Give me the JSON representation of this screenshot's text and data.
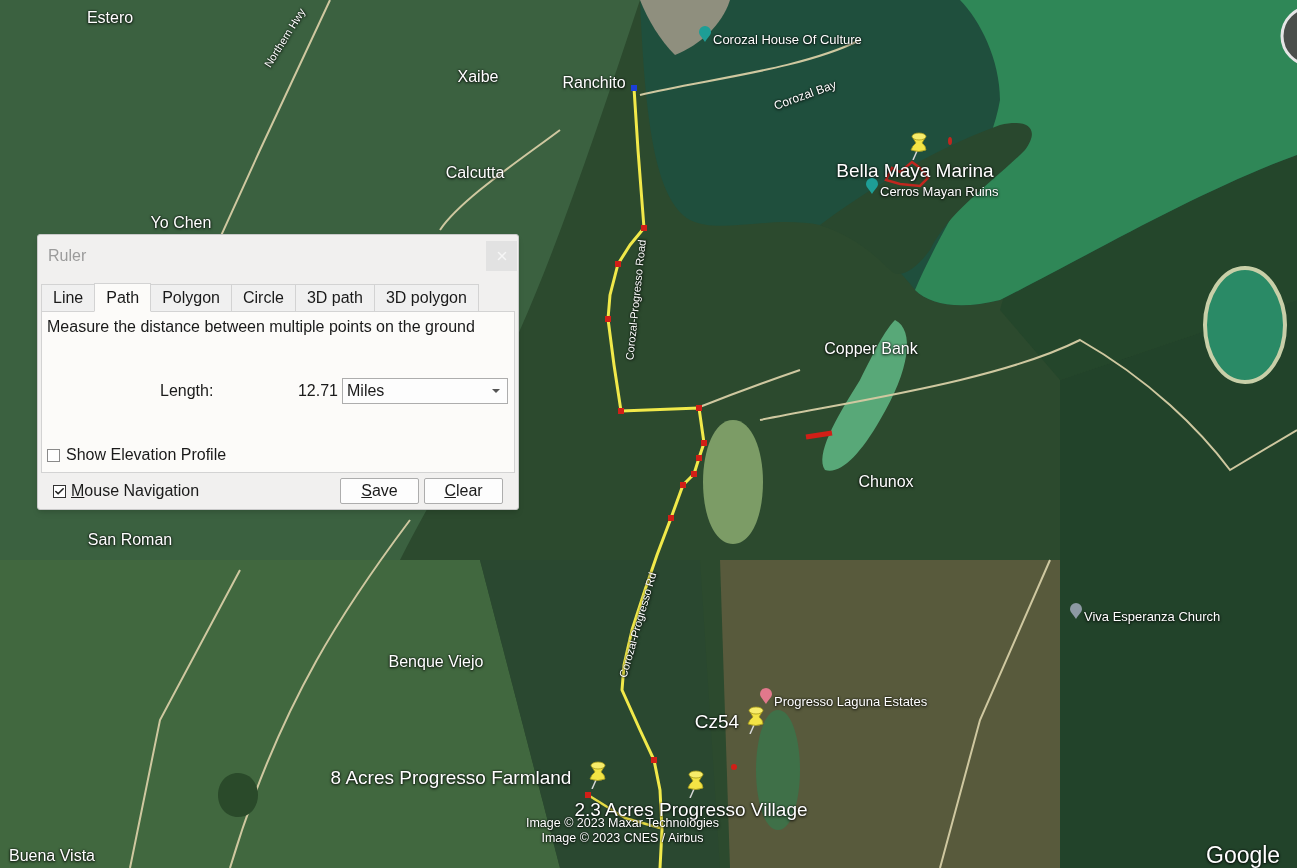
{
  "map": {
    "labels": [
      {
        "kind": "town",
        "text": "Estero"
      },
      {
        "kind": "poi",
        "text": "Corozal House Of Culture",
        "color": "#1e9e96"
      },
      {
        "kind": "road",
        "text": "Northern Hwy"
      },
      {
        "kind": "town",
        "text": "Xaibe"
      },
      {
        "kind": "town",
        "text": "Ranchito"
      },
      {
        "kind": "bay",
        "text": "Corozal Bay"
      },
      {
        "kind": "town",
        "text": "Calcutta"
      },
      {
        "kind": "placemark",
        "text": "Bella Maya Marina"
      },
      {
        "kind": "poi",
        "text": "Cerros Mayan Ruins",
        "color": "#1e9e96"
      },
      {
        "kind": "town",
        "text": "Yo Chen"
      },
      {
        "kind": "road",
        "text": "Corozal-Progresso Road"
      },
      {
        "kind": "town",
        "text": "Copper Bank"
      },
      {
        "kind": "town",
        "text": "Chunox"
      },
      {
        "kind": "town",
        "text": "San Roman"
      },
      {
        "kind": "poi",
        "text": "Viva Esperanza Church",
        "color": "#8d99a3"
      },
      {
        "kind": "road",
        "text": "Corozal-Progresso Rd"
      },
      {
        "kind": "town",
        "text": "Benque Viejo"
      },
      {
        "kind": "poi",
        "text": "Progresso Laguna Estates",
        "color": "#e2788c"
      },
      {
        "kind": "placemark",
        "text": "Cz54"
      },
      {
        "kind": "placemark",
        "text": "8 Acres Progresso Farmland"
      },
      {
        "kind": "placemark",
        "text": "2.3 Acres Progresso Village"
      },
      {
        "kind": "town",
        "text": "Buena Vista"
      }
    ],
    "attribution": [
      "Image © 2023 Maxar Technologies",
      "Image © 2023 CNES / Airbus"
    ],
    "logo": "Google"
  },
  "ruler": {
    "title": "Ruler",
    "tabs": [
      {
        "label": "Line",
        "selected": false
      },
      {
        "label": "Path",
        "selected": true
      },
      {
        "label": "Polygon",
        "selected": false
      },
      {
        "label": "Circle",
        "selected": false
      },
      {
        "label": "3D path",
        "selected": false
      },
      {
        "label": "3D polygon",
        "selected": false
      }
    ],
    "description": "Measure the distance between multiple points on the ground",
    "length": {
      "label": "Length:",
      "value": "12.71",
      "unit": "Miles"
    },
    "elevation_profile": {
      "label": "Show Elevation Profile",
      "checked": false
    },
    "mouse_navigation": {
      "label": "Mouse Navigation",
      "checked": true
    },
    "buttons": [
      "Save",
      "Clear"
    ]
  }
}
